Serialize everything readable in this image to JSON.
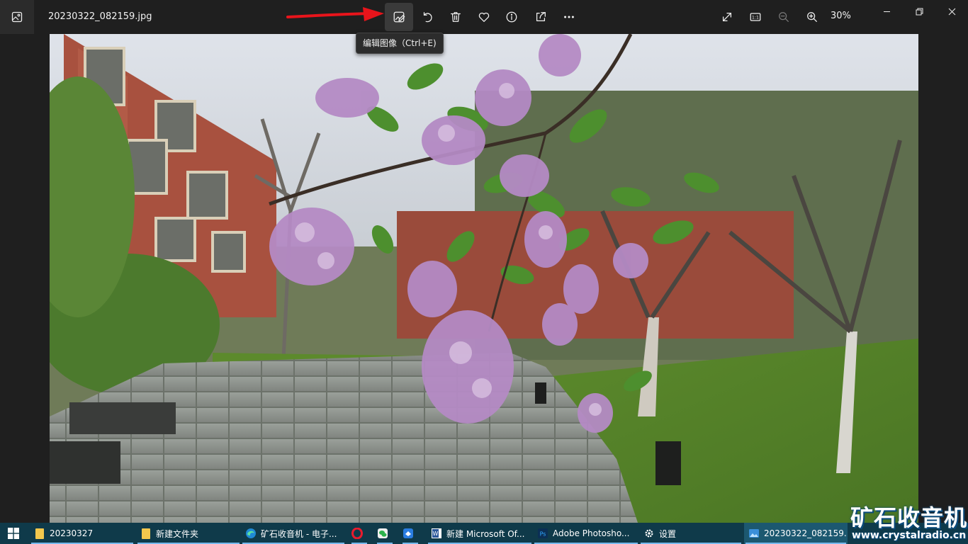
{
  "app": {
    "file_name": "20230322_082159.jpg",
    "zoom_level": "30%"
  },
  "toolbar": {
    "buttons": [
      {
        "name": "edit-image",
        "icon": "edit-image-icon"
      },
      {
        "name": "rotate",
        "icon": "rotate-icon"
      },
      {
        "name": "delete",
        "icon": "trash-icon"
      },
      {
        "name": "favorite",
        "icon": "heart-icon"
      },
      {
        "name": "info",
        "icon": "info-icon"
      },
      {
        "name": "share",
        "icon": "share-icon"
      },
      {
        "name": "more",
        "icon": "more-icon"
      }
    ],
    "tooltip": "编辑图像（Ctrl+E)",
    "right_buttons": [
      {
        "name": "full-screen",
        "icon": "expand-icon"
      },
      {
        "name": "actual-size",
        "icon": "actual-size-icon",
        "label": "1:1"
      },
      {
        "name": "zoom-out",
        "icon": "zoom-out-icon"
      },
      {
        "name": "zoom-in",
        "icon": "zoom-in-icon"
      }
    ]
  },
  "annotation": {
    "color": "#e8141b"
  },
  "taskbar": {
    "items": [
      {
        "label": "20230327",
        "icon": "folder-icon"
      },
      {
        "label": "新建文件夹",
        "icon": "folder-icon"
      },
      {
        "label": "矿石收音机 - 电子...",
        "icon": "edge-icon"
      },
      {
        "label": "",
        "icon": "opera-icon"
      },
      {
        "label": "",
        "icon": "wechat-icon"
      },
      {
        "label": "",
        "icon": "feishu-icon"
      },
      {
        "label": "新建 Microsoft Of...",
        "icon": "word-icon"
      },
      {
        "label": "Adobe Photosho...",
        "icon": "photoshop-icon"
      },
      {
        "label": "设置",
        "icon": "settings-icon"
      },
      {
        "label": "20230322_082159....",
        "icon": "photos-icon"
      }
    ]
  },
  "watermark": {
    "title": "矿石收音机",
    "url": "www.crystalradio.cn"
  },
  "colors": {
    "titlebar_bg": "#1f1f1f",
    "taskbar_bg": "#0f3a4a",
    "taskbar_accent": "#76b9ed"
  }
}
